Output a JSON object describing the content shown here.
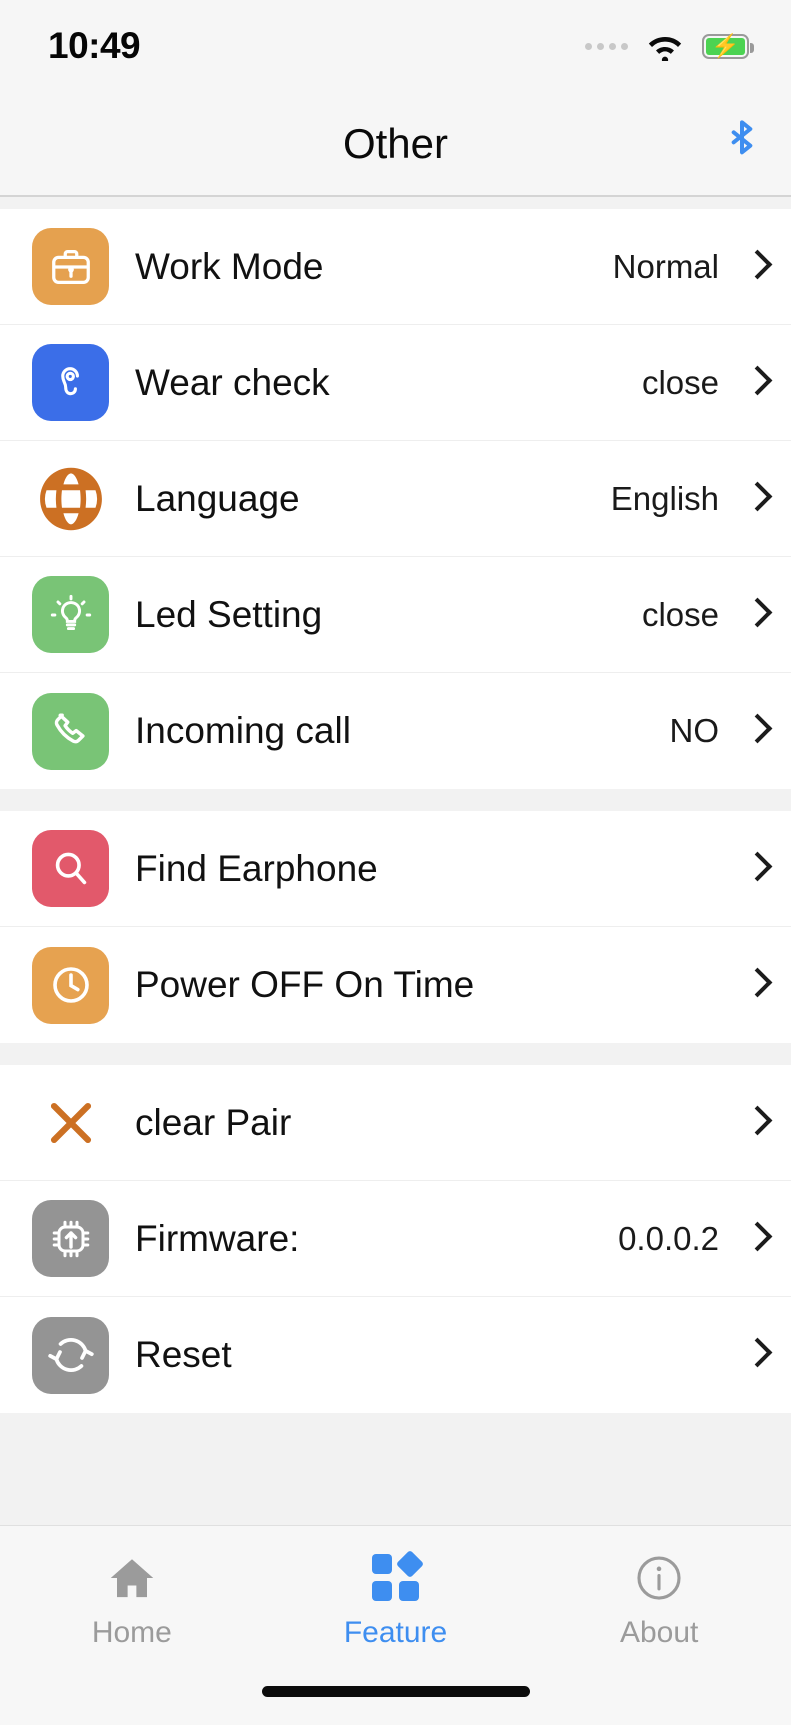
{
  "status_bar": {
    "time": "10:49",
    "signal_icon": "signal-dots-icon",
    "wifi_icon": "wifi-icon",
    "battery_icon": "battery-charging-icon",
    "battery_bolt": "⚡"
  },
  "nav": {
    "title": "Other",
    "bluetooth_icon": "bluetooth-icon",
    "bluetooth_color": "#3e8ef0"
  },
  "groups": [
    {
      "rows": [
        {
          "label": "Work Mode",
          "value": "Normal",
          "icon": "briefcase-icon",
          "icon_color": "#e6a council"
        },
        {
          "label": "Wear check",
          "value": "close",
          "icon": "ear-icon",
          "icon_color": "#3b6ee8"
        },
        {
          "label": "Language",
          "value": "English",
          "icon": "globe-icon",
          "icon_color": "#cc7023"
        },
        {
          "label": "Led Setting",
          "value": "close",
          "icon": "lightbulb-icon",
          "icon_color": "#79c476"
        },
        {
          "label": "Incoming call",
          "value": "NO",
          "icon": "phone-icon",
          "icon_color": "#79c476"
        }
      ]
    },
    {
      "rows": [
        {
          "label": "Find Earphone",
          "value": "",
          "icon": "magnifier-icon",
          "icon_color": "#e2596b"
        },
        {
          "label": "Power OFF On Time",
          "value": "",
          "icon": "clock-icon",
          "icon_color": "#e6a250"
        }
      ]
    },
    {
      "rows": [
        {
          "label": "clear Pair",
          "value": "",
          "icon": "close-x-icon",
          "icon_color": "#cc7023"
        },
        {
          "label": "Firmware:",
          "value": "0.0.0.2",
          "icon": "chip-upload-icon",
          "icon_color": "#949494"
        },
        {
          "label": "Reset",
          "value": "",
          "icon": "refresh-icon",
          "icon_color": "#949494"
        }
      ]
    }
  ],
  "tabs": [
    {
      "label": "Home",
      "icon": "home-icon",
      "active": false
    },
    {
      "label": "Feature",
      "icon": "grid-blocks-icon",
      "active": true
    },
    {
      "label": "About",
      "icon": "info-circle-icon",
      "active": false
    }
  ],
  "colors": {
    "accent": "#3e8ef0",
    "inactive_tab": "#9b9b9b",
    "page_bg": "#f2f2f2",
    "row_bg": "#ffffff"
  }
}
